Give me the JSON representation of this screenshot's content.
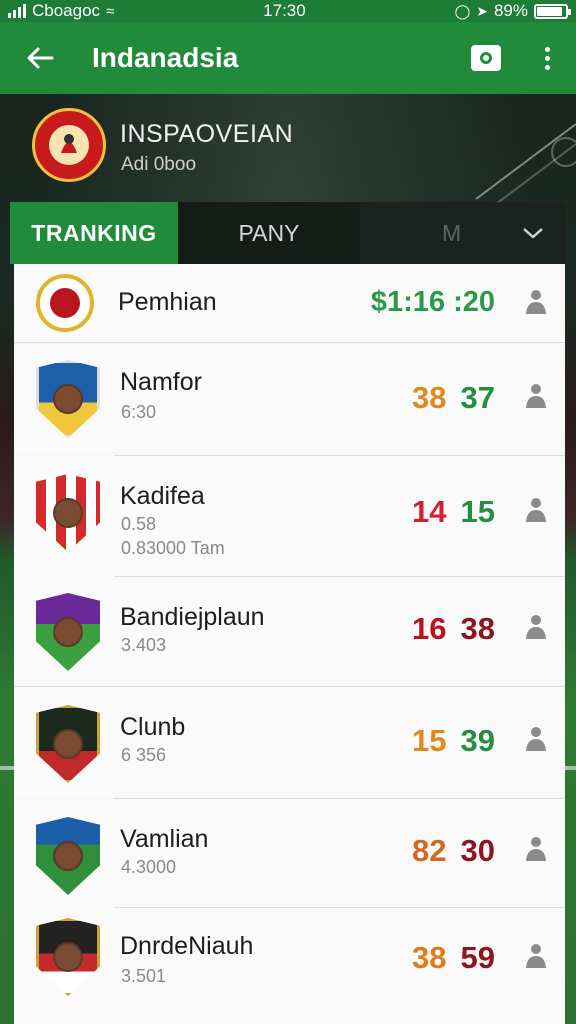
{
  "status_bar": {
    "carrier": "Cboagoc",
    "time": "17:30",
    "battery": "89%"
  },
  "app_bar": {
    "title": "Indanadsia"
  },
  "team": {
    "name": "INSPAOVEIAN",
    "subtitle": "Adi 0boo"
  },
  "tabs": [
    {
      "label": "TRANKING"
    },
    {
      "label": "PANY"
    },
    {
      "label": "M"
    }
  ],
  "rows": [
    {
      "name": "Pemhian",
      "sub": "",
      "sub2": "",
      "score_text": "$1:16 :20",
      "score_a": "",
      "score_b": ""
    },
    {
      "name": "Namfor",
      "sub": "6:30",
      "sub2": "",
      "score_text": "",
      "score_a": "38",
      "score_b": "37",
      "color_a": "#e08a1e",
      "color_b": "#238f3f"
    },
    {
      "name": "Kadifea",
      "sub": "0.58",
      "sub2": "0.83000 Tam",
      "score_text": "",
      "score_a": "14",
      "score_b": "15",
      "color_a": "#d32030",
      "color_b": "#238f3f"
    },
    {
      "name": "Bandiejplaun",
      "sub": "3.403",
      "sub2": "",
      "score_text": "",
      "score_a": "16",
      "score_b": "38",
      "color_a": "#b8141e",
      "color_b": "#8e1420"
    },
    {
      "name": "Clunb",
      "sub": "6 356",
      "sub2": "",
      "score_text": "",
      "score_a": "15",
      "score_b": "39",
      "color_a": "#e08a1e",
      "color_b": "#238f3f"
    },
    {
      "name": "Vamlian",
      "sub": "4.3000",
      "sub2": "",
      "score_text": "",
      "score_a": "82",
      "score_b": "30",
      "color_a": "#d2691e",
      "color_b": "#8e1420"
    },
    {
      "name": "DnrdeNiauh",
      "sub": "3.501",
      "sub2": "",
      "score_text": "",
      "score_a": "38",
      "score_b": "59",
      "color_a": "#e07a1e",
      "color_b": "#8e1420"
    }
  ],
  "colors": {
    "brand_green": "#1f8b3b",
    "status_green": "#1d7d36"
  },
  "icons": [
    "signal-icon",
    "wifi-icon",
    "location-icon",
    "alarm-icon",
    "battery-icon",
    "back-arrow-icon",
    "camera-icon",
    "more-vert-icon",
    "chevron-down-icon",
    "user-icon"
  ]
}
